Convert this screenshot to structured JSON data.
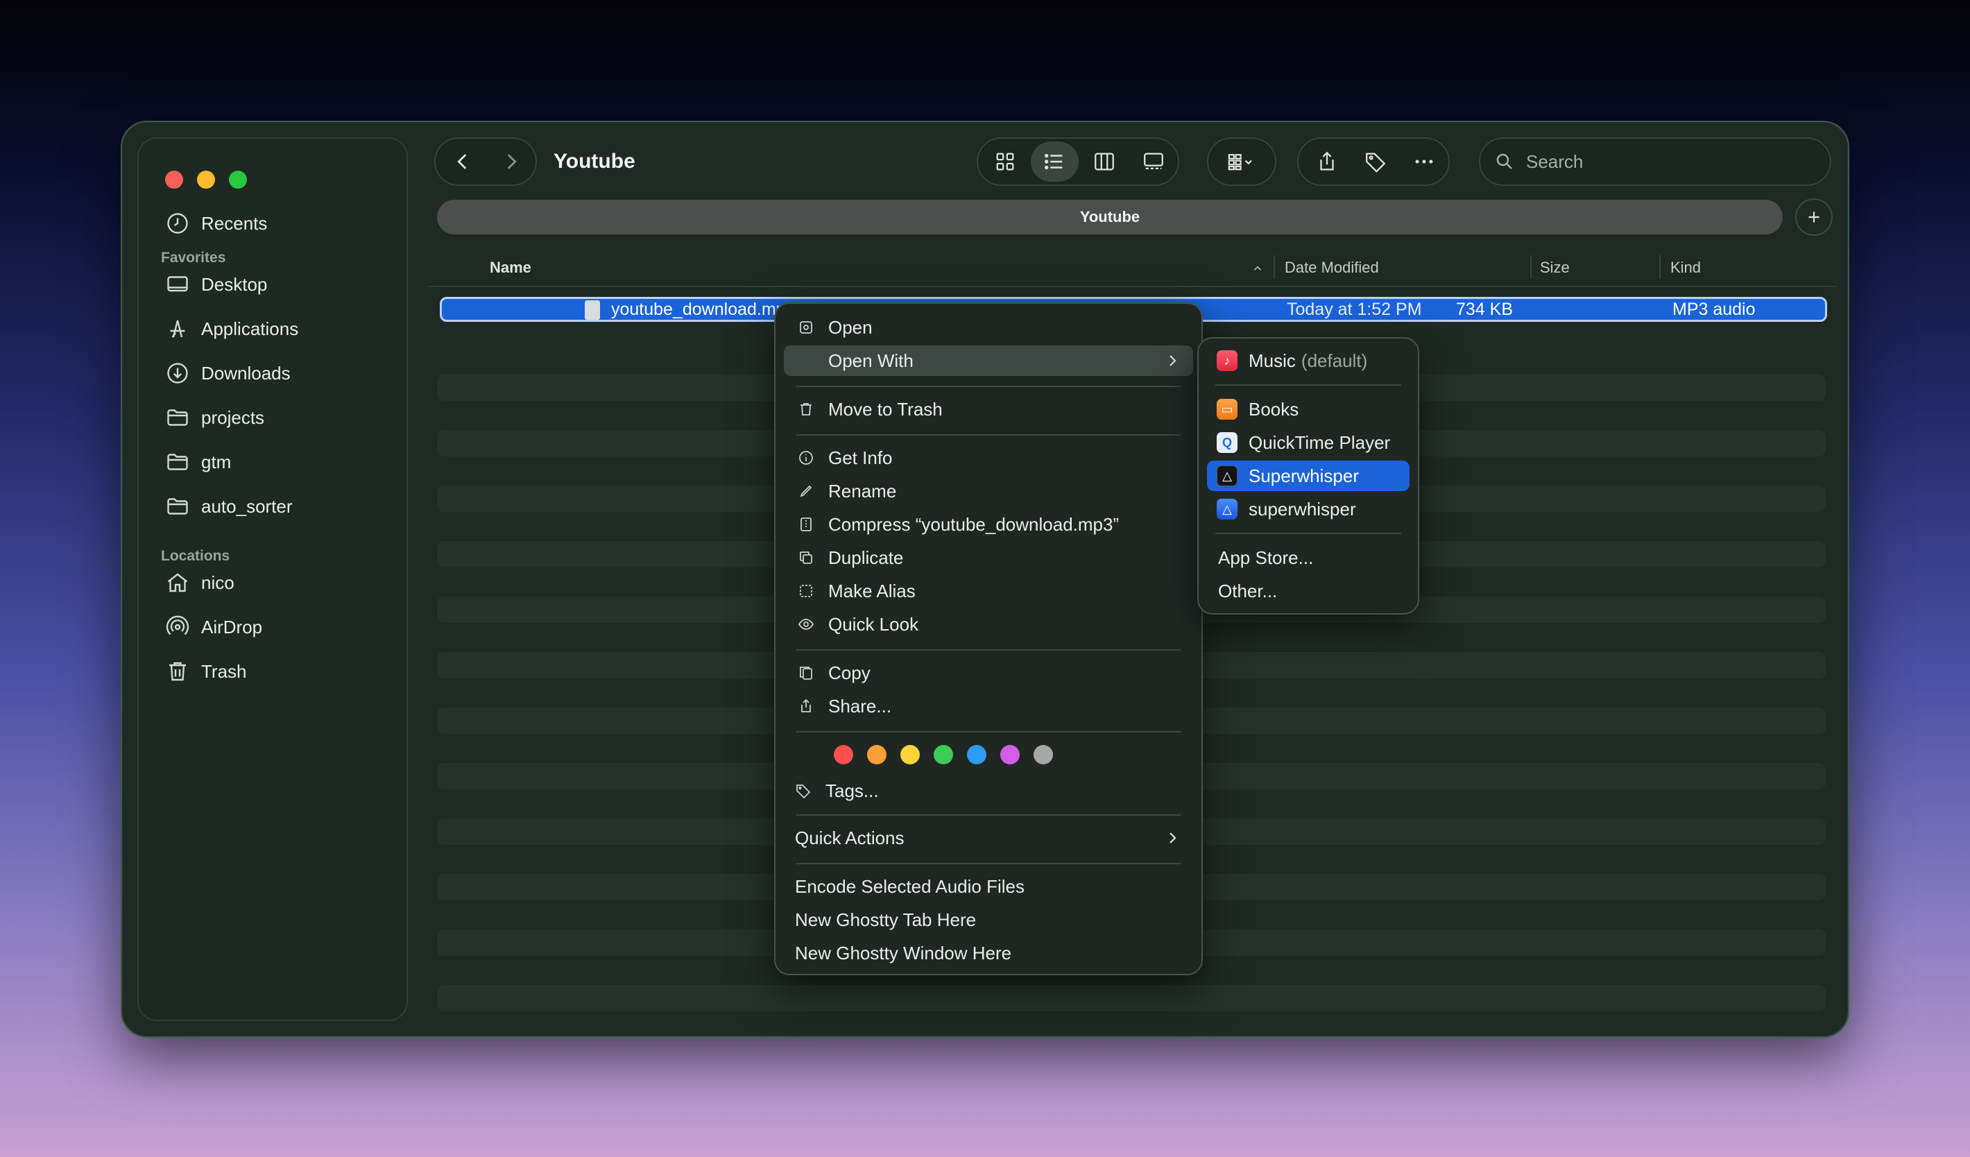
{
  "window": {
    "title": "Youtube",
    "tab_label": "Youtube"
  },
  "sidebar": {
    "recents": "Recents",
    "favorites_heading": "Favorites",
    "favorites": [
      "Desktop",
      "Applications",
      "Downloads",
      "projects",
      "gtm",
      "auto_sorter"
    ],
    "locations_heading": "Locations",
    "locations": [
      "nico",
      "AirDrop",
      "Trash"
    ]
  },
  "search": {
    "placeholder": "Search"
  },
  "columns": {
    "name": "Name",
    "date": "Date Modified",
    "size": "Size",
    "kind": "Kind"
  },
  "file": {
    "name": "youtube_download.mp3",
    "date": "Today at 1:52 PM",
    "size": "734 KB",
    "kind": "MP3 audio"
  },
  "context_menu": {
    "open": "Open",
    "open_with": "Open With",
    "move_to_trash": "Move to Trash",
    "get_info": "Get Info",
    "rename": "Rename",
    "compress": "Compress “youtube_download.mp3”",
    "duplicate": "Duplicate",
    "make_alias": "Make Alias",
    "quick_look": "Quick Look",
    "copy": "Copy",
    "share": "Share...",
    "tag_colors": [
      "#ff4f4f",
      "#ff9f3a",
      "#ffd43a",
      "#3dcc55",
      "#2e9bf5",
      "#d25ee8",
      "#a7a7a7"
    ],
    "tags": "Tags...",
    "quick_actions": "Quick Actions",
    "encode": "Encode Selected Audio Files",
    "ghostty_tab": "New Ghostty Tab Here",
    "ghostty_window": "New Ghostty Window Here"
  },
  "open_with_menu": {
    "music": "Music",
    "music_default": "(default)",
    "books": "Books",
    "quicktime": "QuickTime Player",
    "superwhisper_1": "Superwhisper",
    "superwhisper_2": "superwhisper",
    "app_store": "App Store...",
    "other": "Other..."
  },
  "accent_color": "#1a63d9"
}
